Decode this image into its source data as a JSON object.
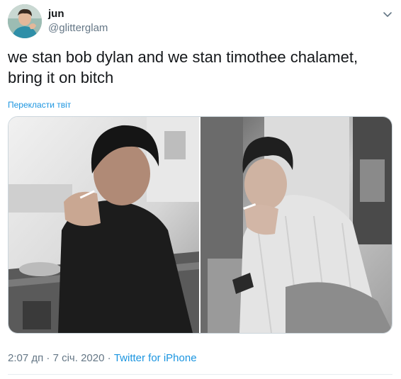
{
  "author": {
    "display_name": "jun",
    "handle": "@glitterglam",
    "avatar_icon": "profile-photo"
  },
  "menu": {
    "icon": "chevron-down-icon"
  },
  "tweet": {
    "text": "we stan bob dylan and we stan timothee chalamet, bring it on bitch",
    "translate_label": "Перекласти твіт"
  },
  "media": {
    "photos": [
      {
        "description_icon": "photo-black-and-white-man-lighting-cigarette"
      },
      {
        "description_icon": "photo-black-and-white-young-man-smoking"
      }
    ]
  },
  "meta": {
    "time": "2:07 дп",
    "separator": "·",
    "date": "7 січ. 2020",
    "source": "Twitter for iPhone"
  },
  "colors": {
    "text": "#14171a",
    "secondary": "#657786",
    "link": "#1b95e0",
    "border": "#ccd6dd"
  }
}
